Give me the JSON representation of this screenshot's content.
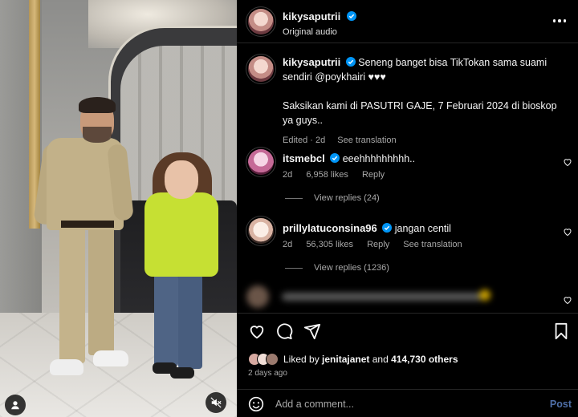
{
  "colors": {
    "link": "#4f6fa8",
    "muted": "#a8a8a8",
    "verified": "#0095f6",
    "background": "#000000"
  },
  "header": {
    "username": "kikysaputrii",
    "subtitle": "Original audio"
  },
  "caption": {
    "username": "kikysaputrii",
    "text_line1": "Seneng banget bisa TikTokan sama suami sendiri",
    "mention": "@poykhairi",
    "emoji": "♥♥♥",
    "text_line2": "Saksikan kami di PASUTRI GAJE, 7 Februari 2024 di bioskop ya guys..",
    "edited": "Edited · 2d",
    "see_translation": "See translation"
  },
  "comments": [
    {
      "username": "itsmebcl",
      "text": "eeehhhhhhhhh..",
      "age": "2d",
      "likes": "6,958 likes",
      "reply": "Reply",
      "view_replies": "View replies (24)"
    },
    {
      "username": "prillylatuconsina96",
      "text": "jangan centil",
      "age": "2d",
      "likes": "56,305 likes",
      "reply": "Reply",
      "see_translation": "See translation",
      "view_replies": "View replies (1236)"
    }
  ],
  "likes": {
    "prefix": "Liked by",
    "user": "jenitajanet",
    "and": "and",
    "count": "414,730 others"
  },
  "post_date": "2 days ago",
  "comment_box": {
    "placeholder": "Add a comment...",
    "post_label": "Post"
  },
  "icons": [
    "more-icon",
    "heart-icon",
    "comment-icon",
    "share-icon",
    "bookmark-icon",
    "emoji-icon",
    "mute-icon",
    "profile-icon",
    "verified-icon"
  ]
}
